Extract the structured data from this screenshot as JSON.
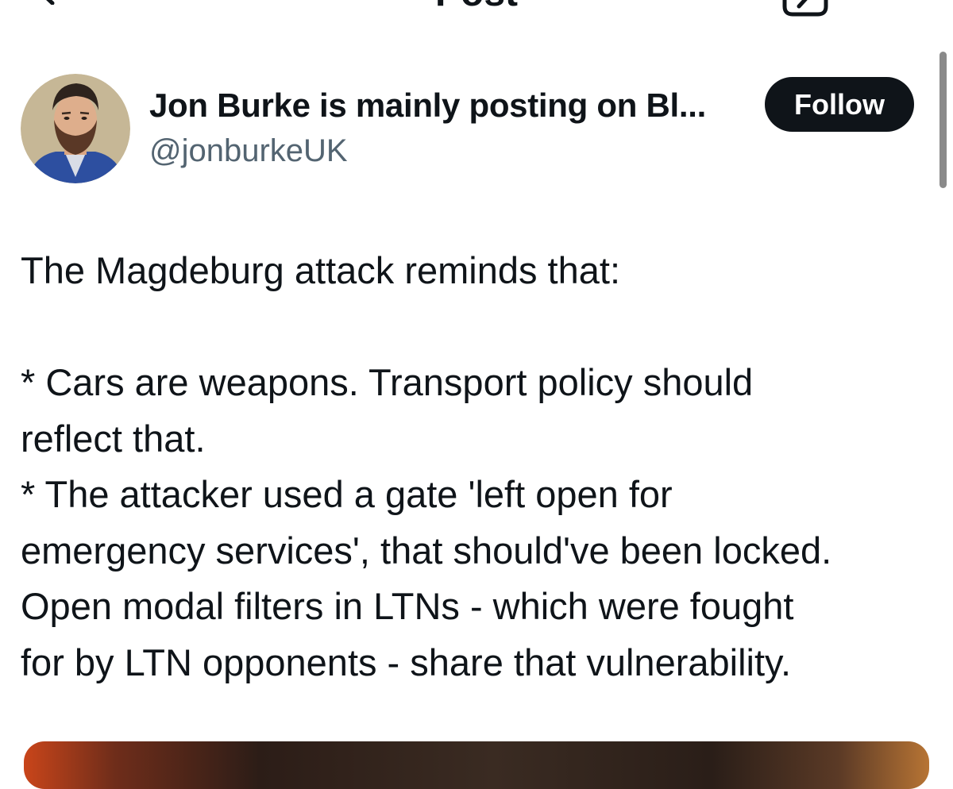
{
  "header": {
    "title": "Post",
    "back_icon": "chevron-left-icon",
    "share_icon": "share-icon"
  },
  "author": {
    "display_name": "Jon Burke is mainly posting on Bl...",
    "handle": "@jonburkeUK",
    "avatar": "profile-photo"
  },
  "follow_button": {
    "label": "Follow"
  },
  "post": {
    "lines": [
      "The Magdeburg attack reminds that:",
      "",
      "* Cars are weapons. Transport policy should",
      "reflect that.",
      "* The attacker used a gate 'left open for",
      "emergency services', that should've been locked.",
      "Open modal filters in LTNs - which were fought",
      "for by LTN opponents - share that vulnerability."
    ]
  },
  "colors": {
    "text": "#0f1419",
    "secondary_text": "#536471",
    "button_bg": "#0f1419",
    "button_text": "#ffffff",
    "background": "#ffffff"
  }
}
